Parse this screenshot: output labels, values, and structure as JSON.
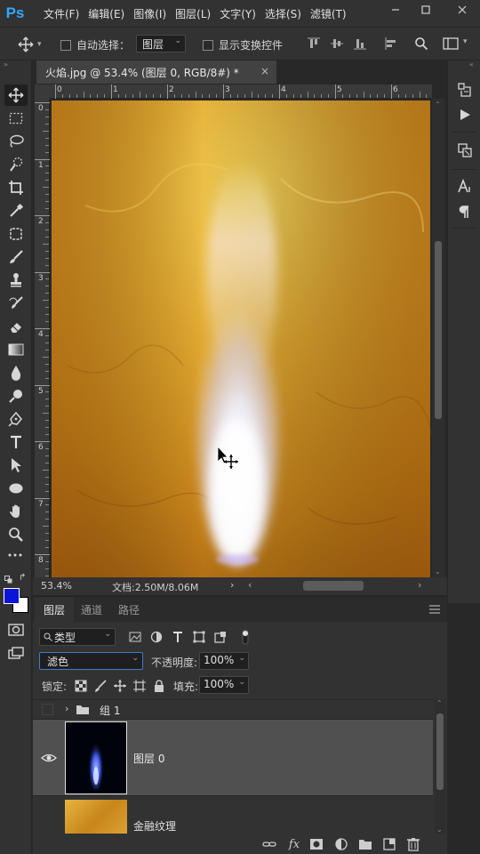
{
  "app": {
    "logo": "Ps"
  },
  "menu": [
    "文件(F)",
    "编辑(E)",
    "图像(I)",
    "图层(L)",
    "文字(Y)",
    "选择(S)",
    "滤镜(T)"
  ],
  "options": {
    "auto_select_label": "自动选择：",
    "auto_select_value": "图层",
    "show_transform_label": "显示变换控件"
  },
  "document": {
    "tab_title": "火焰.jpg @ 53.4% (图层 0, RGB/8#) *",
    "zoom": "53.4%",
    "doc_size": "文档:2.50M/8.06M"
  },
  "ruler": {
    "h_ticks": [
      "0",
      "1",
      "2",
      "3",
      "4",
      "5",
      "6"
    ],
    "v_ticks": [
      "0",
      "1",
      "2",
      "3",
      "4",
      "5",
      "6",
      "7",
      "8"
    ]
  },
  "colors": {
    "foreground": "#0a14d8",
    "background": "#ffffff",
    "accent": "#31a8ff"
  },
  "layers_panel": {
    "tabs": [
      "图层",
      "通道",
      "路径"
    ],
    "filter_kind": "类型",
    "blend_mode": "滤色",
    "opacity_label": "不透明度:",
    "opacity_value": "100%",
    "lock_label": "锁定:",
    "fill_label": "填充:",
    "fill_value": "100%",
    "layers": [
      {
        "name": "组 1",
        "type": "group"
      },
      {
        "name": "图层 0",
        "type": "pixel",
        "selected": true,
        "visible": true
      },
      {
        "name": "金融纹理",
        "type": "pixel"
      }
    ]
  }
}
